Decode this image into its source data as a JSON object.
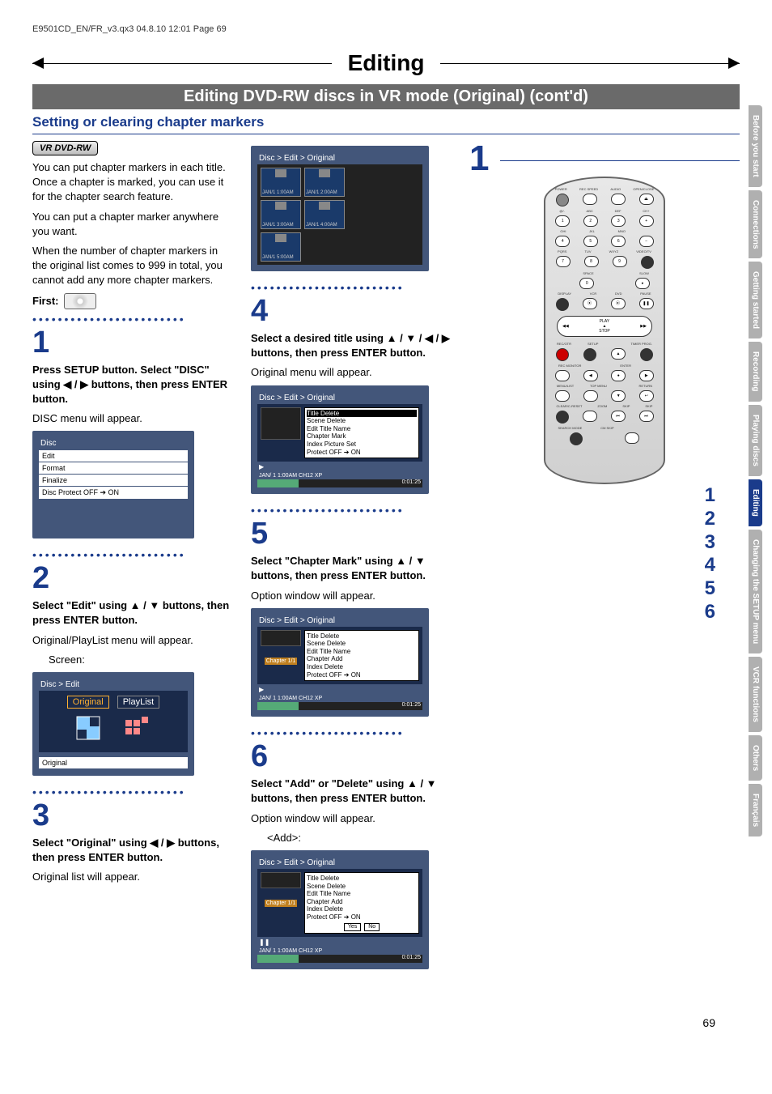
{
  "header": "E9501CD_EN/FR_v3.qx3  04.8.10  12:01  Page 69",
  "title": "Editing",
  "subtitle": "Editing DVD-RW discs in VR mode (Original) (cont'd)",
  "section": "Setting or clearing chapter markers",
  "badge": "VR DVD-RW",
  "intro1": "You can put chapter markers in each title. Once a chapter is marked, you can use it for the chapter search feature.",
  "intro2": "You can put a chapter marker anywhere you want.",
  "intro3": "When the number of chapter markers in the original list comes to 999 in total, you cannot add any more chapter markers.",
  "first_label": "First:",
  "steps": {
    "1": {
      "num": "1",
      "head": "Press SETUP button. Select \"DISC\" using ◀ / ▶ buttons, then press ENTER button.",
      "sub": "DISC menu will appear."
    },
    "2": {
      "num": "2",
      "head": "Select \"Edit\" using ▲ / ▼ buttons, then press ENTER button.",
      "sub": "Original/PlayList menu will appear.",
      "screen_label": "Screen:"
    },
    "3": {
      "num": "3",
      "head": "Select \"Original\" using ◀ / ▶ buttons, then press ENTER button.",
      "sub": "Original list will appear."
    },
    "4": {
      "num": "4",
      "head": "Select a desired title using ▲ / ▼ / ◀ / ▶ buttons, then press ENTER button.",
      "sub": "Original menu will appear."
    },
    "5": {
      "num": "5",
      "head": "Select \"Chapter Mark\" using ▲ / ▼ buttons, then press ENTER button.",
      "sub": "Option window will appear."
    },
    "6": {
      "num": "6",
      "head": "Select \"Add\" or \"Delete\" using ▲ / ▼ buttons, then press ENTER button.",
      "sub": "Option window will appear.",
      "add_label": "<Add>:"
    }
  },
  "disc_menu": {
    "title": "Disc",
    "items": [
      "Edit",
      "Format",
      "Finalize",
      "Disc Protect OFF ➔ ON"
    ]
  },
  "edit_menu": {
    "breadcrumb": "Disc > Edit",
    "original": "Original",
    "playlist": "PlayList",
    "footer": "Original"
  },
  "thumb_grid": {
    "breadcrumb": "Disc > Edit > Original",
    "thumbs": [
      "JAN/1  1:00AM",
      "JAN/1  2:00AM",
      "JAN/1  3:00AM",
      "JAN/1  4:00AM",
      "JAN/1  5:00AM"
    ]
  },
  "title_menu": {
    "breadcrumb": "Disc > Edit > Original",
    "items": [
      "Title Delete",
      "Scene Delete",
      "Edit Title Name",
      "Chapter Mark",
      "Index Picture Set",
      "Protect OFF ➔ ON"
    ],
    "status": "JAN/ 1   1:00AM  CH12      XP",
    "time": "0:01:25"
  },
  "chapter_menu": {
    "breadcrumb": "Disc > Edit > Original",
    "badge": "Chapter 1/1",
    "items": [
      "Title Delete",
      "Scene Delete",
      "Edit Title Name",
      "Chapter Add",
      "Index Delete",
      "Protect OFF ➔ ON"
    ],
    "status": "JAN/ 1   1:00AM  CH12      XP",
    "time": "0:01:25"
  },
  "add_menu": {
    "breadcrumb": "Disc > Edit > Original",
    "badge": "Chapter 1/1",
    "items": [
      "Title Delete",
      "Scene Delete",
      "Edit Title Name",
      "Chapter Add",
      "Index Delete",
      "Protect OFF ➔ ON"
    ],
    "yes": "Yes",
    "no": "No",
    "status": "JAN/ 1   1:00AM  CH12      XP",
    "time": "0:01:25"
  },
  "remote": {
    "row0": [
      "POWER",
      "REC SPEED",
      "AUDIO",
      "OPEN/CLOSE"
    ],
    "row1": [
      "@/.",
      "ABC",
      "DEF",
      "CH+"
    ],
    "row2": [
      "GHI",
      "JKL",
      "MNO",
      "CH-"
    ],
    "row3": [
      "PQRS",
      "TUV",
      "WXYZ",
      "VIDEO/TV"
    ],
    "row4": [
      "",
      "SPACE",
      "",
      "SLOW"
    ],
    "row5": [
      "DISPLAY",
      "VCR",
      "DVD",
      "PAUSE"
    ],
    "play": "PLAY",
    "stop": "STOP",
    "row6": [
      "REC/OTR",
      "SETUP",
      "",
      "TIMER PROG."
    ],
    "row7": [
      "REC MONITOR",
      "",
      "ENTER",
      ""
    ],
    "row8": [
      "MENU/LIST",
      "TOP MENU",
      "",
      "RETURN"
    ],
    "row9": [
      "CLEAR/C-RESET",
      "ZOOM",
      "SKIP",
      "SKIP"
    ],
    "row10": [
      "SEARCH MODE",
      "CM SKIP",
      "",
      ""
    ]
  },
  "step_numbers_right": [
    "1",
    "2",
    "3",
    "4",
    "5",
    "6"
  ],
  "big_one": "1",
  "sidebar": [
    "Before you start",
    "Connections",
    "Getting started",
    "Recording",
    "Playing discs",
    "Editing",
    "Changing the SETUP menu",
    "VCR functions",
    "Others",
    "Français"
  ],
  "page_number": "69"
}
